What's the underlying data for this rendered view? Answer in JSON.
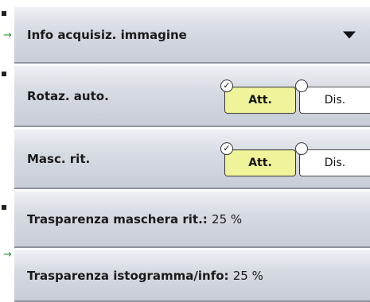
{
  "menu": {
    "header": {
      "label": "Info acquisiz. immagine",
      "icon": "triangle-down-icon"
    },
    "auto_rotate": {
      "label": "Rotaz. auto.",
      "on_label": "Att.",
      "off_label": "Dis.",
      "selected": "on"
    },
    "mask": {
      "label": "Masc. rit.",
      "on_label": "Att.",
      "off_label": "Dis.",
      "selected": "on"
    },
    "mask_transparency": {
      "label": "Trasparenza maschera rit.:",
      "value": "25 %"
    },
    "histogram_transparency": {
      "label": "Trasparenza istogramma/info:",
      "value": "25 %"
    }
  },
  "colors": {
    "active": "#eff39a",
    "row": "#d7dbe3",
    "pointer": "#2e9a3a"
  }
}
